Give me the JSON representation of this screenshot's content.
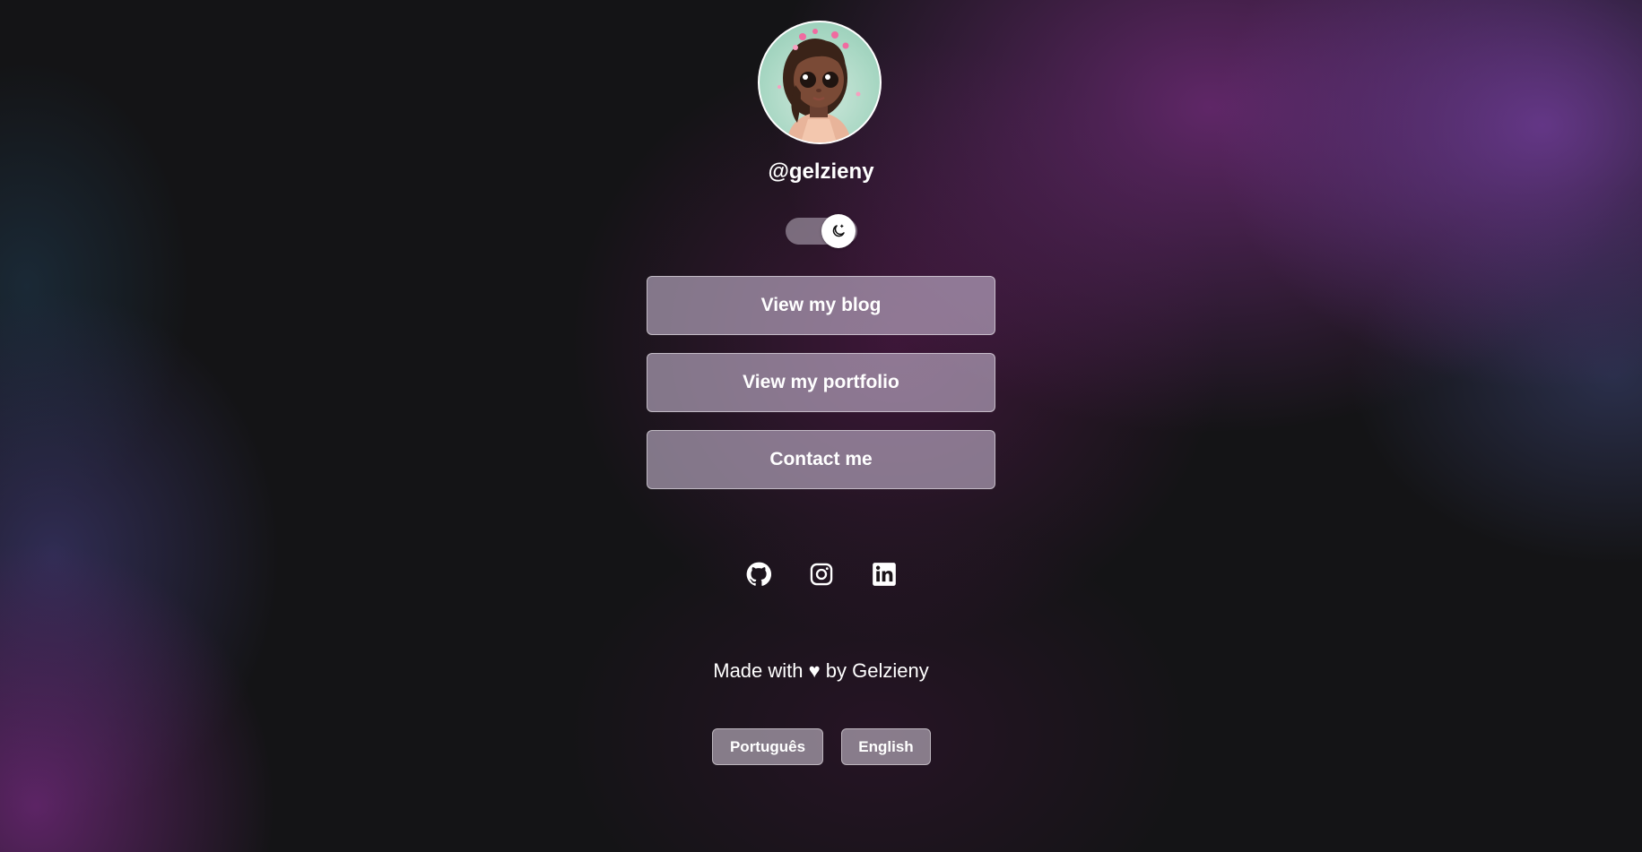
{
  "profile": {
    "username": "@gelzieny",
    "avatar_alt": "avatar"
  },
  "theme_toggle": {
    "icon": "moon-icon",
    "state": "dark"
  },
  "links": [
    {
      "label": "View my blog"
    },
    {
      "label": "View my portfolio"
    },
    {
      "label": "Contact me"
    }
  ],
  "social": [
    {
      "icon": "github-icon"
    },
    {
      "icon": "instagram-icon"
    },
    {
      "icon": "linkedin-icon"
    }
  ],
  "footer": {
    "text": "Made with ♥ by Gelzieny"
  },
  "languages": [
    {
      "label": "Português"
    },
    {
      "label": "English"
    }
  ],
  "colors": {
    "background": "#141416",
    "accent_purple": "#6e3c96",
    "button_bg": "#c8b9d2",
    "text": "#ffffff"
  }
}
